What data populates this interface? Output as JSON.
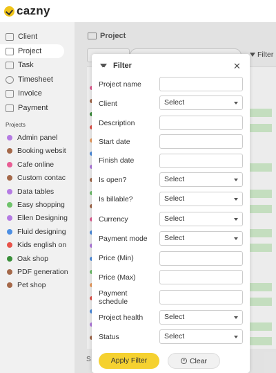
{
  "app": {
    "logo_text": "cazny"
  },
  "sidebar": {
    "items": [
      {
        "label": "Client",
        "icon": "client-icon"
      },
      {
        "label": "Project",
        "icon": "folder-icon",
        "active": true
      },
      {
        "label": "Task",
        "icon": "task-icon"
      },
      {
        "label": "Timesheet",
        "icon": "clock-icon"
      },
      {
        "label": "Invoice",
        "icon": "invoice-icon"
      },
      {
        "label": "Payment",
        "icon": "payment-icon"
      }
    ],
    "projects_heading": "Projects",
    "projects": [
      {
        "label": "Admin panel",
        "color": "#b57be3"
      },
      {
        "label": "Booking websit",
        "color": "#a5694a"
      },
      {
        "label": "Cafe online",
        "color": "#e85d94"
      },
      {
        "label": "Custom contac",
        "color": "#a5694a"
      },
      {
        "label": "Data tables",
        "color": "#b57be3"
      },
      {
        "label": "Easy shopping",
        "color": "#6fc36b"
      },
      {
        "label": "Ellen Designing",
        "color": "#b57be3"
      },
      {
        "label": "Fluid designing",
        "color": "#4d8fe3"
      },
      {
        "label": "Kids english on",
        "color": "#e8534a"
      },
      {
        "label": "Oak shop",
        "color": "#3a8f3a"
      },
      {
        "label": "PDF generation",
        "color": "#a5694a"
      },
      {
        "label": "Pet shop",
        "color": "#a5694a"
      }
    ]
  },
  "main": {
    "title": "Project",
    "filter_label": "Filter",
    "bottom_text": "S"
  },
  "modal": {
    "title": "Filter",
    "close_glyph": "✕",
    "fields": [
      {
        "label": "Project name",
        "type": "input",
        "value": ""
      },
      {
        "label": "Client",
        "type": "select",
        "value": "Select"
      },
      {
        "label": "Description",
        "type": "input",
        "value": ""
      },
      {
        "label": "Start date",
        "type": "input",
        "value": ""
      },
      {
        "label": "Finish date",
        "type": "input",
        "value": ""
      },
      {
        "label": "Is open?",
        "type": "select",
        "value": "Select"
      },
      {
        "label": "Is billable?",
        "type": "select",
        "value": "Select"
      },
      {
        "label": "Currency",
        "type": "select",
        "value": "Select"
      },
      {
        "label": "Payment mode",
        "type": "select",
        "value": "Select"
      },
      {
        "label": "Price (Min)",
        "type": "input",
        "value": ""
      },
      {
        "label": "Price (Max)",
        "type": "input",
        "value": ""
      },
      {
        "label": "Payment schedule",
        "type": "input",
        "value": ""
      },
      {
        "label": "Project health",
        "type": "select",
        "value": "Select"
      },
      {
        "label": "Status",
        "type": "select",
        "value": "Select"
      }
    ],
    "apply_label": "Apply Filter",
    "clear_label": "Clear",
    "clear_glyph": "×"
  },
  "colors": {
    "accent": "#f5d130",
    "chip_green": "#cde8c7"
  }
}
